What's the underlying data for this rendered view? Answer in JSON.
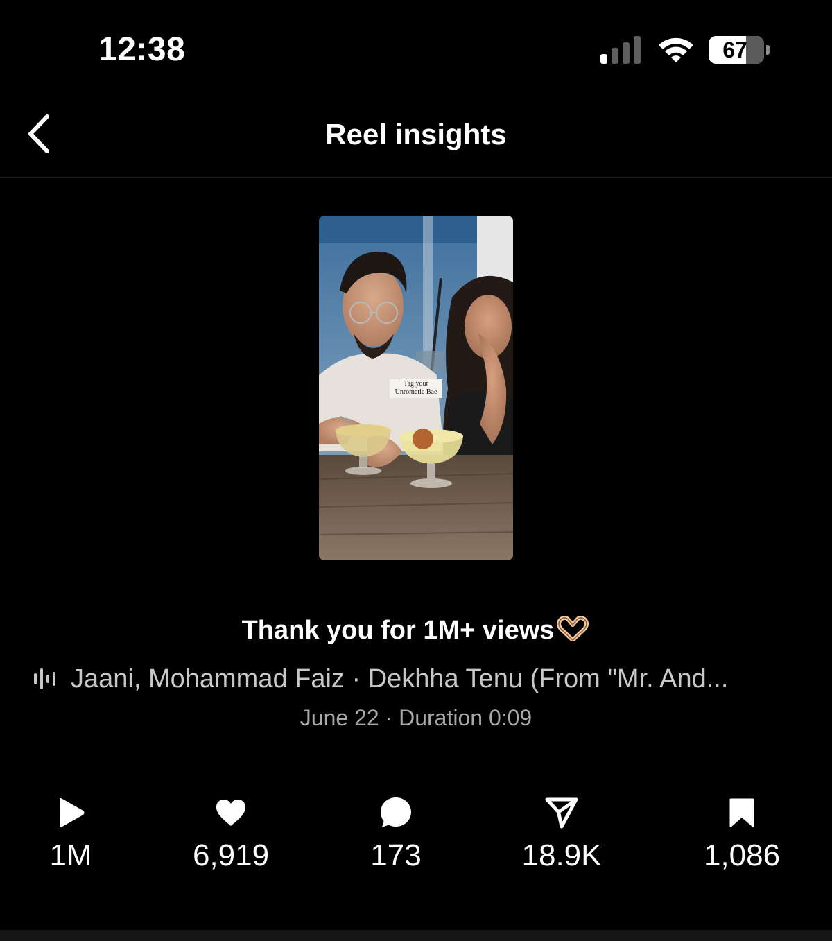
{
  "status_bar": {
    "time": "12:38",
    "battery_percent": "67",
    "battery_level": 0.67,
    "signal_icon": "cellular-signal-icon",
    "wifi_icon": "wifi-icon"
  },
  "nav": {
    "back_icon": "chevron-left-icon",
    "title": "Reel insights"
  },
  "reel": {
    "thumbnail_sticker_line1": "Tag your",
    "thumbnail_sticker_line2": "Unromatic Bae",
    "caption": "Thank you for 1M+ views",
    "caption_emoji": "heart-hands-emoji",
    "audio_icon": "audio-waveform-icon",
    "audio": "Jaani, Mohammad Faiz · Dekhha Tenu (From \"Mr. And...",
    "date": "June 22",
    "separator": "·",
    "duration": "Duration 0:09"
  },
  "stats": [
    {
      "name": "plays",
      "icon": "play-icon",
      "value": "1M"
    },
    {
      "name": "likes",
      "icon": "heart-icon",
      "value": "6,919"
    },
    {
      "name": "comments",
      "icon": "comment-icon",
      "value": "173"
    },
    {
      "name": "shares",
      "icon": "share-icon",
      "value": "18.9K"
    },
    {
      "name": "saves",
      "icon": "bookmark-icon",
      "value": "1,086"
    }
  ],
  "colors": {
    "background": "#000000",
    "text_primary": "#ffffff",
    "text_secondary": "#c8c8c8",
    "text_tertiary": "#a8a8a8"
  }
}
